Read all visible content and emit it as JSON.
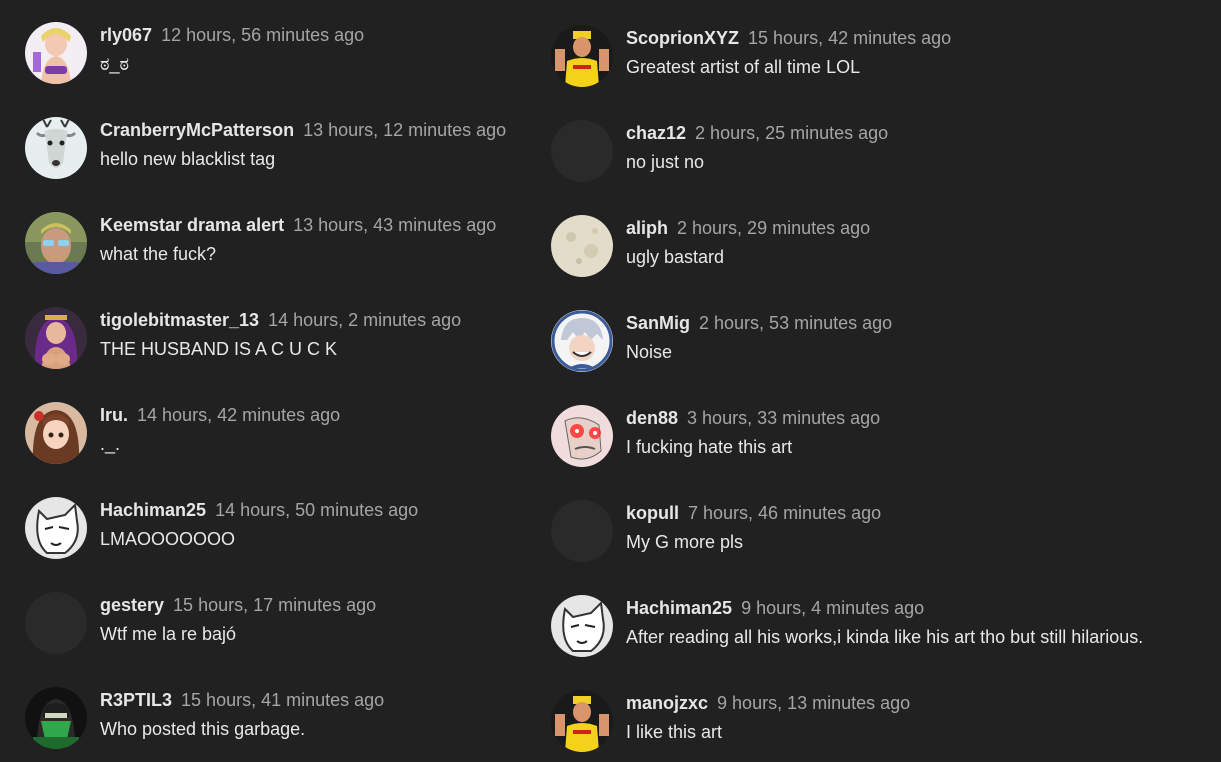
{
  "left_column": [
    {
      "user": "rly067",
      "time": "12 hours, 56 minutes ago",
      "text": "ಠ_ಠ",
      "avatar": "anime-girl-purple"
    },
    {
      "user": "CranberryMcPatterson",
      "time": "13 hours, 12 minutes ago",
      "text": "hello new blacklist tag",
      "avatar": "deer"
    },
    {
      "user": "Keemstar drama alert",
      "time": "13 hours, 43 minutes ago",
      "text": "what the fuck?",
      "avatar": "man-sunglasses"
    },
    {
      "user": "tigolebitmaster_13",
      "time": "14 hours, 2 minutes ago",
      "text": "THE HUSBAND IS A C U C K",
      "avatar": "anime-woman-dark"
    },
    {
      "user": "Iru.",
      "time": "14 hours, 42 minutes ago",
      "text": "._.",
      "avatar": "anime-girl-brown"
    },
    {
      "user": "Hachiman25",
      "time": "14 hours, 50 minutes ago",
      "text": "LMAOOOOOOO",
      "avatar": "white-wolf"
    },
    {
      "user": "gestery",
      "time": "15 hours, 17 minutes ago",
      "text": "Wtf me la re bajó",
      "avatar": "blank"
    },
    {
      "user": "R3PTIL3",
      "time": "15 hours, 41 minutes ago",
      "text": "Who posted this garbage.",
      "avatar": "green-ninja"
    }
  ],
  "right_column": [
    {
      "user": "ScoprionXYZ",
      "time": "15 hours, 42 minutes ago",
      "text": "Greatest artist of all time LOL",
      "avatar": "wrestler"
    },
    {
      "user": "chaz12",
      "time": "2 hours, 25 minutes ago",
      "text": "no just no",
      "avatar": "blank"
    },
    {
      "user": "aliph",
      "time": "2 hours, 29 minutes ago",
      "text": "ugly bastard",
      "avatar": "moon"
    },
    {
      "user": "SanMig",
      "time": "2 hours, 53 minutes ago",
      "text": "Noise",
      "avatar": "anime-silver-hair"
    },
    {
      "user": "den88",
      "time": "3 hours, 33 minutes ago",
      "text": "I fucking hate this art",
      "avatar": "red-eyes-meme"
    },
    {
      "user": "kopull",
      "time": "7 hours, 46 minutes ago",
      "text": "My G more pls",
      "avatar": "blank"
    },
    {
      "user": "Hachiman25",
      "time": "9 hours, 4 minutes ago",
      "text": "After reading all his works,i kinda like his art tho but still hilarious.",
      "avatar": "white-wolf"
    },
    {
      "user": "manojzxc",
      "time": "9 hours, 13 minutes ago",
      "text": "I like this art",
      "avatar": "wrestler"
    }
  ]
}
